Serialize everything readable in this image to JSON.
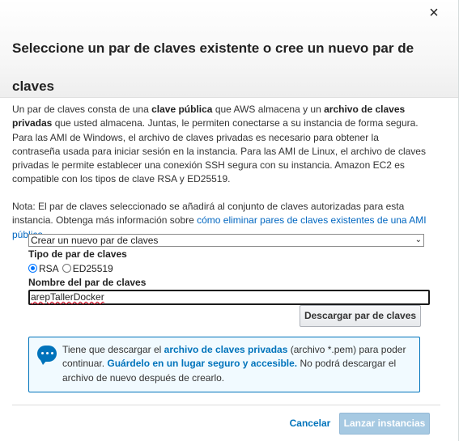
{
  "dialog": {
    "title": "Seleccione un par de claves existente o cree un nuevo par de claves",
    "close_symbol": "×"
  },
  "intro": {
    "t1": "Un par de claves consta de una ",
    "b1": "clave pública",
    "t2": " que AWS almacena y un ",
    "b2": "archivo de claves privadas",
    "t3": " que usted almacena. Juntas, le permiten conectarse a su instancia de forma segura. Para las AMI de Windows, el archivo de claves privadas es necesario para obtener la contraseña usada para iniciar sesión en la instancia. Para las AMI de Linux, el archivo de claves privadas le permite establecer una conexión SSH segura con su instancia. Amazon EC2 es compatible con los tipos de clave RSA y ED25519."
  },
  "note": {
    "text": "Nota: El par de claves seleccionado se añadirá al conjunto de claves autorizadas para esta instancia. Obtenga más información sobre ",
    "link": "cómo eliminar pares de claves existentes de una AMI pública",
    "end": "."
  },
  "form": {
    "key_pair_option": "Crear un nuevo par de claves",
    "key_type_label": "Tipo de par de claves",
    "key_type_options": [
      {
        "label": "RSA",
        "selected": true
      },
      {
        "label": "ED25519",
        "selected": false
      }
    ],
    "key_name_label": "Nombre del par de claves",
    "key_name_value": "arepTallerDocker",
    "download_button": "Descargar par de claves"
  },
  "info": {
    "icon": "speech-bubble-icon",
    "t1": "Tiene que descargar el ",
    "b1": "archivo de claves privadas",
    "t2": " (archivo *.pem) para poder continuar. ",
    "b2": "Guárdelo en un lugar seguro y accesible.",
    "t3": " No podrá descargar el archivo de nuevo después de crearlo."
  },
  "footer": {
    "cancel_label": "Cancelar",
    "launch_label": "Lanzar instancias"
  },
  "colors": {
    "link": "#0066c0",
    "info_border": "#0073bb",
    "info_bg": "#f1faff",
    "launch_disabled": "#a6c9e2"
  }
}
